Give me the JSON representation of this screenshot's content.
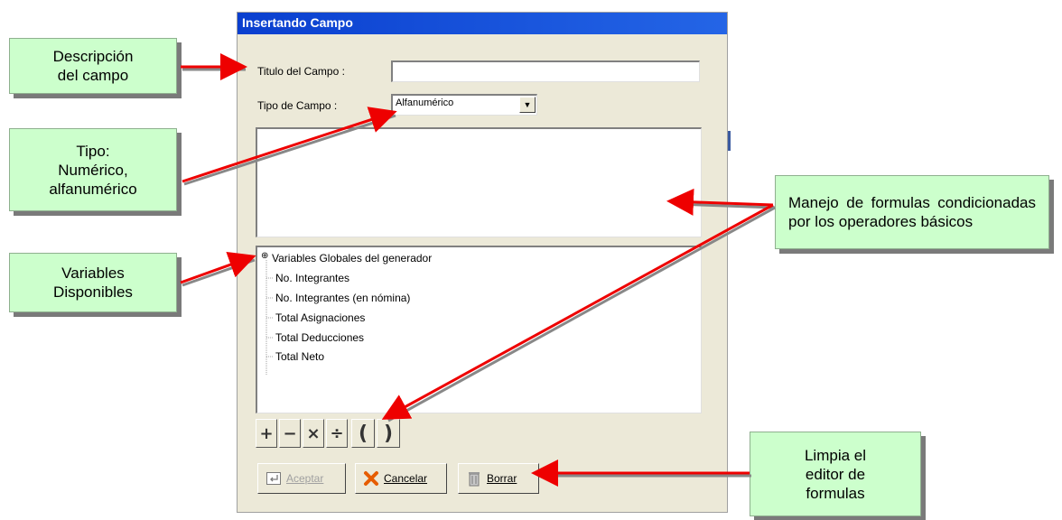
{
  "dialog": {
    "title": "Insertando Campo",
    "titulo_label": "Titulo del Campo :",
    "titulo_value": "",
    "tipo_label": "Tipo de Campo :",
    "tipo_value": "Alfanumérico",
    "formula_value": ""
  },
  "tree": {
    "root": "Variables Globales del generador",
    "items": [
      "No. Integrantes",
      "No. Integrantes (en nómina)",
      "Total Asignaciones",
      "Total Deducciones",
      "Total Neto"
    ]
  },
  "operators": [
    "+",
    "−",
    "×",
    "÷",
    "(",
    ")"
  ],
  "buttons": {
    "aceptar": "Aceptar",
    "cancelar": "Cancelar",
    "borrar": "Borrar"
  },
  "callouts": {
    "descripcion": "Descripción\ndel campo",
    "tipo": "Tipo:\nNumérico,\nalfanumérico",
    "variables": "Variables\nDisponibles",
    "manejo": "Manejo de formulas condicionadas por los operadores básicos",
    "limpia": "Limpia el\neditor de\nformulas"
  },
  "colors": {
    "callout_bg": "#ccffcc",
    "arrow": "#ee0000",
    "titlebar": "#0a3fcf"
  }
}
